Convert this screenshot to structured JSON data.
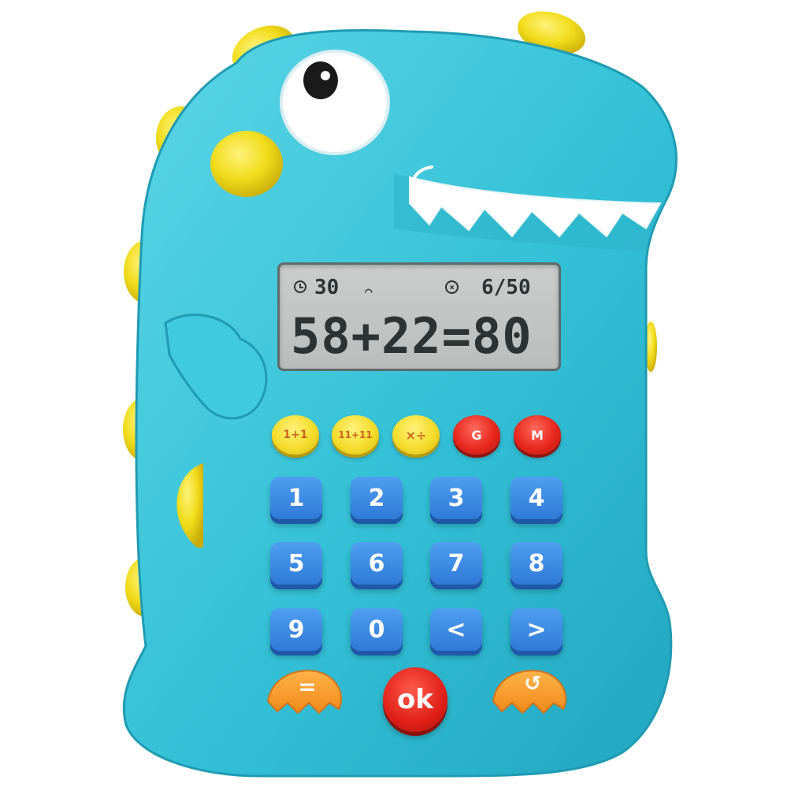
{
  "lcd": {
    "timer": "30",
    "progress": "6/50",
    "expression": "58+22=80"
  },
  "function_keys": [
    {
      "label": "1+1",
      "color": "yellow"
    },
    {
      "label": "11+11",
      "color": "yellow"
    },
    {
      "label": "×÷",
      "color": "yellow"
    },
    {
      "label": "G",
      "color": "red"
    },
    {
      "label": "M",
      "color": "red"
    }
  ],
  "number_keys": [
    "1",
    "2",
    "3",
    "4",
    "5",
    "6",
    "7",
    "8",
    "9",
    "0",
    "<",
    ">"
  ],
  "bottom_keys": {
    "equals": "=",
    "ok": "ok",
    "back": "↺"
  },
  "colors": {
    "body": "#35c4d8",
    "spikes": "#f0dc1a",
    "number_keys": "#2f7ad8",
    "ok_key": "#e01f17",
    "side_keys": "#f59a2c"
  }
}
